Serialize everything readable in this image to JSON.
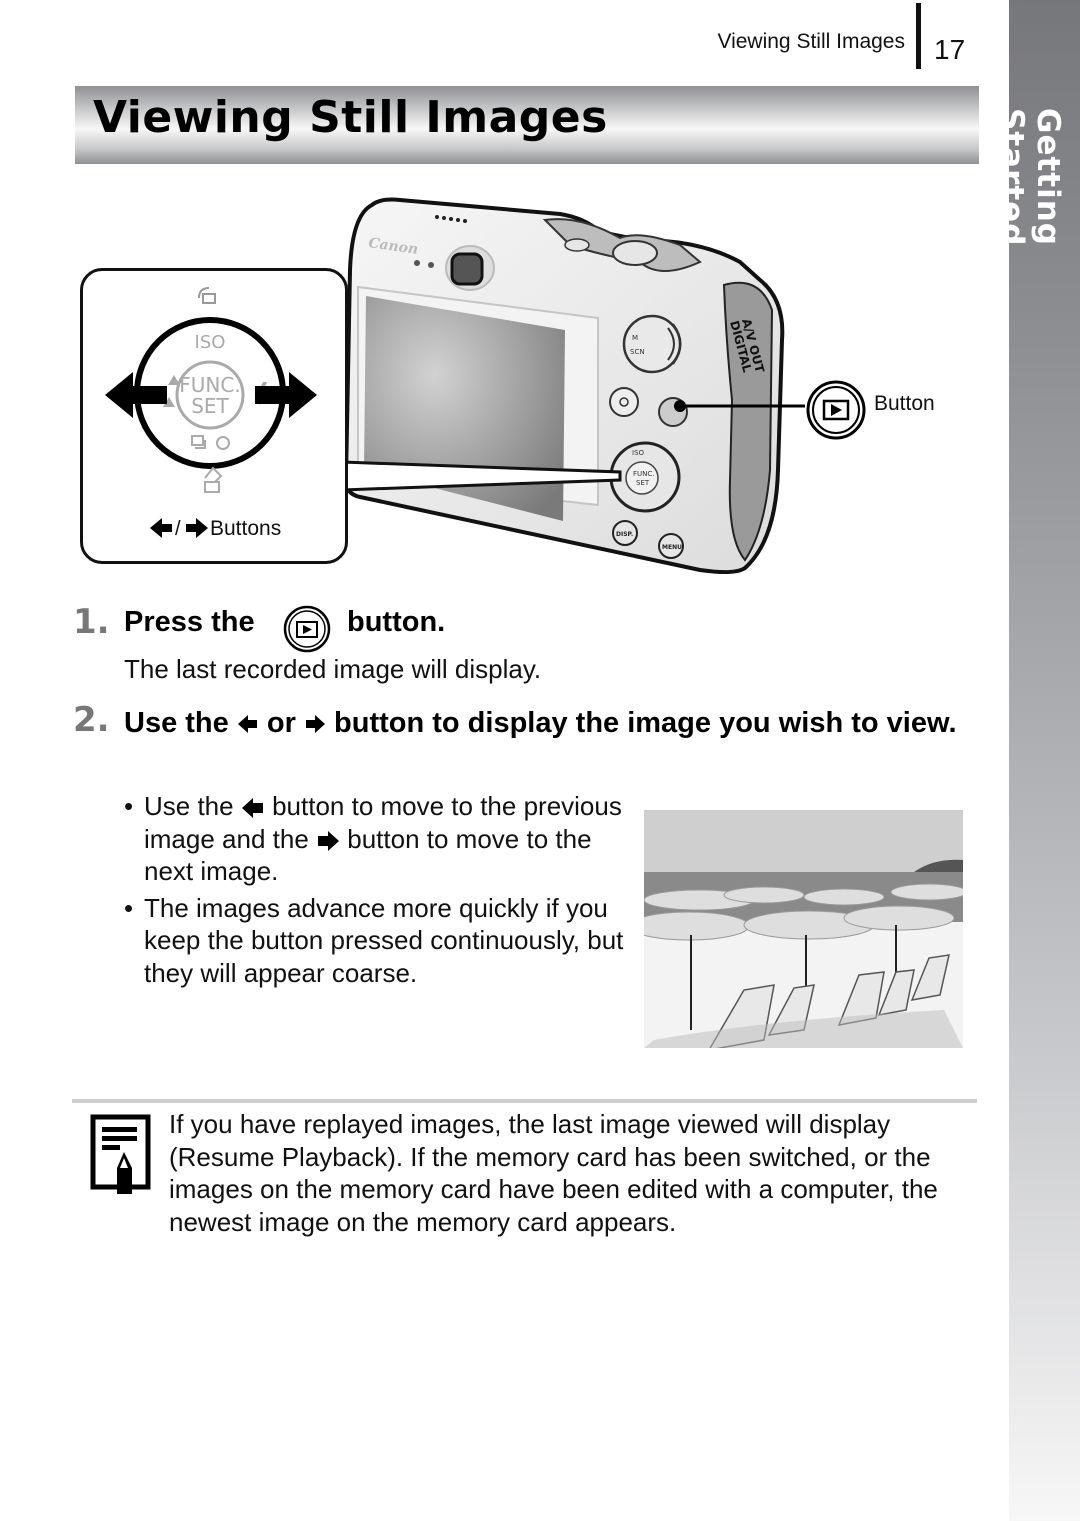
{
  "header": {
    "running_title": "Viewing Still Images",
    "page_number": "17"
  },
  "side_tab": {
    "label": "Getting Started"
  },
  "title": "Viewing Still Images",
  "figure": {
    "callout_label": "Buttons",
    "callout_separator": "/",
    "playback_label": "Button",
    "dial_center_top": "FUNC.",
    "dial_center_bottom": "SET",
    "dial_top_label": "ISO",
    "camera_brand": "Canon",
    "camera_port_label_1": "A/V OUT",
    "camera_port_label_2": "DIGITAL",
    "camera_buttons": [
      "DISP.",
      "MENU"
    ]
  },
  "steps": [
    {
      "number": "1.",
      "title_before_icon": "Press the",
      "icon": "playback-icon",
      "title_after_icon": "button.",
      "description": "The last recorded image will display."
    },
    {
      "number": "2.",
      "title_part1": "Use the",
      "icon_left": "left-arrow-icon",
      "title_part2": "or",
      "icon_right": "right-arrow-icon",
      "title_part3": "button to display the image you wish to view.",
      "bullets": [
        {
          "part1": "Use the",
          "icon1": "left-arrow-icon",
          "part2": "button to move to the previous image and the",
          "icon2": "right-arrow-icon",
          "part3": "button to move to the next image."
        },
        {
          "text": "The images advance more quickly if you keep the button pressed continuously, but they will appear coarse."
        }
      ]
    }
  ],
  "sample_photo": {
    "description": "Black-and-white beach scene with umbrellas and lounge chairs"
  },
  "note": {
    "icon": "note-pencil-icon",
    "text": "If you have replayed images, the last image viewed will display (Resume Playback). If the memory card has been switched, or the images on the memory card have been edited with a computer, the newest image on the memory card appears."
  }
}
